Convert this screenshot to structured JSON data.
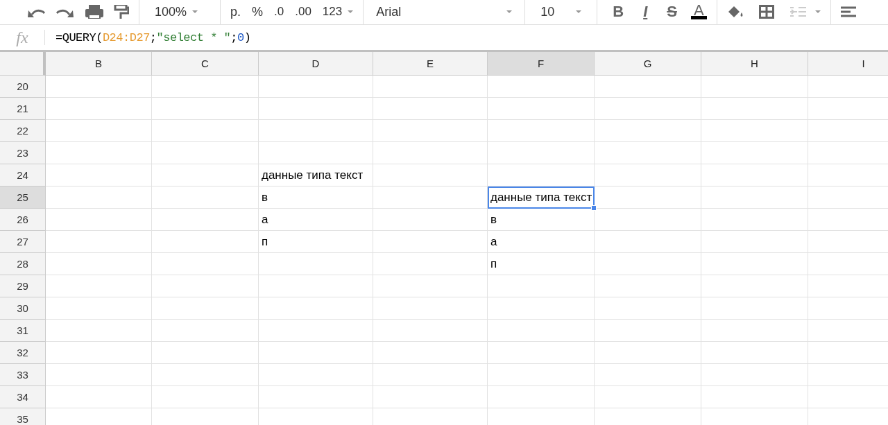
{
  "toolbar": {
    "zoom": "100%",
    "currency": "р.",
    "percent": "%",
    "decrease_decimals": ".0",
    "increase_decimals": ".00",
    "more_formats": "123",
    "font": "Arial",
    "font_size": "10",
    "bold": "B",
    "italic": "I",
    "strikethrough": "S",
    "text_color": "A",
    "merge_disabled": true
  },
  "formula_bar": {
    "label": "fx",
    "formula": [
      {
        "kind": "plain",
        "text": "=QUERY("
      },
      {
        "kind": "range",
        "text": "D24:D27"
      },
      {
        "kind": "plain",
        "text": ";"
      },
      {
        "kind": "string",
        "text": "\"select * \""
      },
      {
        "kind": "plain",
        "text": ";"
      },
      {
        "kind": "number",
        "text": "0"
      },
      {
        "kind": "plain",
        "text": ")"
      }
    ]
  },
  "columns": [
    {
      "label": "B",
      "selected": false
    },
    {
      "label": "C",
      "selected": false
    },
    {
      "label": "D",
      "selected": false
    },
    {
      "label": "E",
      "selected": false
    },
    {
      "label": "F",
      "selected": true
    },
    {
      "label": "G",
      "selected": false
    },
    {
      "label": "H",
      "selected": false
    },
    {
      "label": "I",
      "selected": false
    }
  ],
  "rows": [
    {
      "label": "20",
      "selected": false,
      "cells": [
        null,
        null,
        null,
        null,
        null,
        null,
        null,
        null
      ]
    },
    {
      "label": "21",
      "selected": false,
      "cells": [
        null,
        null,
        null,
        null,
        null,
        null,
        null,
        null
      ]
    },
    {
      "label": "22",
      "selected": false,
      "cells": [
        null,
        null,
        null,
        null,
        null,
        null,
        null,
        null
      ]
    },
    {
      "label": "23",
      "selected": false,
      "cells": [
        null,
        null,
        null,
        null,
        null,
        null,
        null,
        null
      ]
    },
    {
      "label": "24",
      "selected": false,
      "cells": [
        null,
        null,
        {
          "text": "данные типа текст",
          "selected": false
        },
        null,
        null,
        null,
        null,
        null
      ]
    },
    {
      "label": "25",
      "selected": true,
      "cells": [
        null,
        null,
        {
          "text": "в",
          "selected": false
        },
        null,
        {
          "text": "данные типа текст",
          "selected": true
        },
        null,
        null,
        null
      ]
    },
    {
      "label": "26",
      "selected": false,
      "cells": [
        null,
        null,
        {
          "text": "а",
          "selected": false
        },
        null,
        {
          "text": "в",
          "selected": false
        },
        null,
        null,
        null
      ]
    },
    {
      "label": "27",
      "selected": false,
      "cells": [
        null,
        null,
        {
          "text": "п",
          "selected": false
        },
        null,
        {
          "text": "а",
          "selected": false
        },
        null,
        null,
        null
      ]
    },
    {
      "label": "28",
      "selected": false,
      "cells": [
        null,
        null,
        null,
        null,
        {
          "text": "п",
          "selected": false
        },
        null,
        null,
        null
      ]
    },
    {
      "label": "29",
      "selected": false,
      "cells": [
        null,
        null,
        null,
        null,
        null,
        null,
        null,
        null
      ]
    },
    {
      "label": "30",
      "selected": false,
      "cells": [
        null,
        null,
        null,
        null,
        null,
        null,
        null,
        null
      ]
    },
    {
      "label": "31",
      "selected": false,
      "cells": [
        null,
        null,
        null,
        null,
        null,
        null,
        null,
        null
      ]
    },
    {
      "label": "32",
      "selected": false,
      "cells": [
        null,
        null,
        null,
        null,
        null,
        null,
        null,
        null
      ]
    },
    {
      "label": "33",
      "selected": false,
      "cells": [
        null,
        null,
        null,
        null,
        null,
        null,
        null,
        null
      ]
    },
    {
      "label": "34",
      "selected": false,
      "cells": [
        null,
        null,
        null,
        null,
        null,
        null,
        null,
        null
      ]
    },
    {
      "label": "35",
      "selected": false,
      "cells": [
        null,
        null,
        null,
        null,
        null,
        null,
        null,
        null
      ]
    }
  ]
}
